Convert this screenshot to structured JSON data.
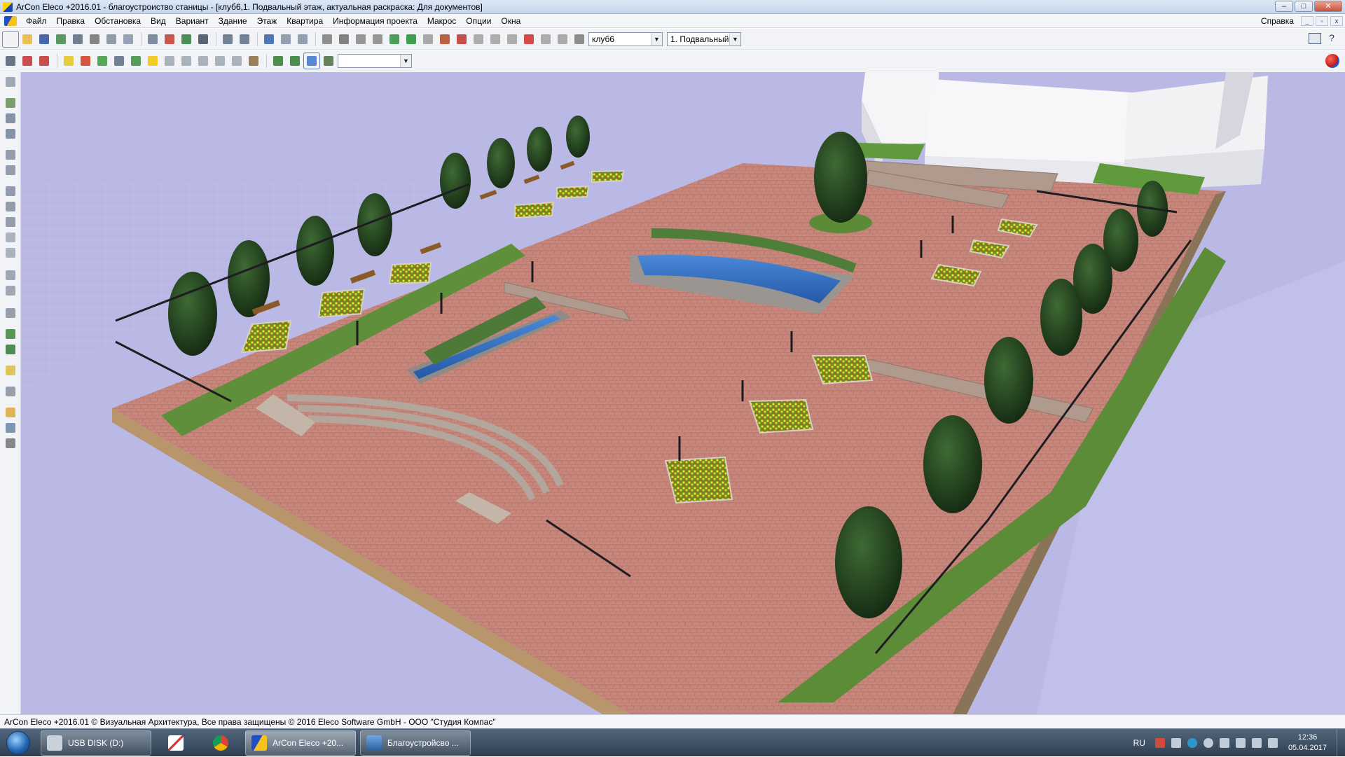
{
  "window": {
    "title": "ArCon Eleco  +2016.01 - благоустроиство станицы - [клуб6,1. Подвальный этаж, актуальная раскраска: Для документов]",
    "controls": [
      "–",
      "□",
      "✕"
    ]
  },
  "menubar": {
    "items": [
      "Файл",
      "Правка",
      "Обстановка",
      "Вид",
      "Вариант",
      "Здание",
      "Этаж",
      "Квартира",
      "Информация проекта",
      "Макрос",
      "Опции",
      "Окна"
    ],
    "help": "Справка"
  },
  "toolbar": {
    "building_select": "клуб6",
    "floor_select": "1. Подвальный",
    "extra_select": ""
  },
  "status": {
    "text": "ArCon Eleco +2016.01 © Визуальная Архитектура, Все права защищены © 2016 Eleco Software GmbH - ООО \"Студия Компас\""
  },
  "taskbar": {
    "items": [
      {
        "label": "USB DISK (D:)",
        "icon": "drive-icon"
      },
      {
        "label": "",
        "icon": "mail-icon"
      },
      {
        "label": "",
        "icon": "chrome-icon"
      },
      {
        "label": "ArCon Eleco  +20...",
        "icon": "arcon-icon"
      },
      {
        "label": "Благоустройсво ...",
        "icon": "image-viewer-icon"
      }
    ],
    "lang": "RU",
    "time": "12:36",
    "date": "05.04.2017"
  },
  "scene": {
    "description_colors": {
      "sky": "#b6b4e0",
      "paving": "#c7867b",
      "lawn": "#5f8f3a",
      "water": "#2f6fc0",
      "building": "#f4f4f4"
    }
  }
}
